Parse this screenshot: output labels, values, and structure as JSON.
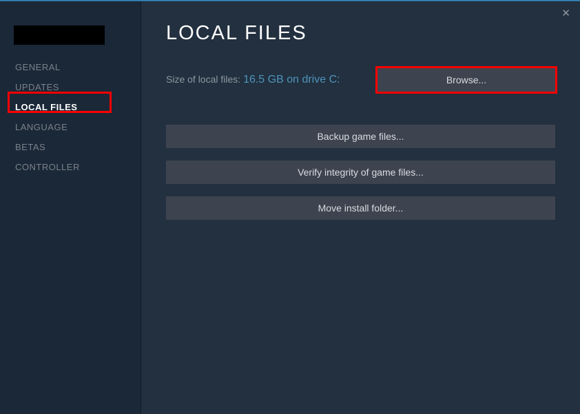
{
  "sidebar": {
    "items": [
      {
        "label": "GENERAL"
      },
      {
        "label": "UPDATES"
      },
      {
        "label": "LOCAL FILES"
      },
      {
        "label": "LANGUAGE"
      },
      {
        "label": "BETAS"
      },
      {
        "label": "CONTROLLER"
      }
    ]
  },
  "page": {
    "title": "LOCAL FILES",
    "size_label": "Size of local files: ",
    "size_value": "16.5 GB on drive C:"
  },
  "buttons": {
    "browse": "Browse...",
    "backup": "Backup game files...",
    "verify": "Verify integrity of game files...",
    "move": "Move install folder..."
  },
  "close_icon": "✕"
}
